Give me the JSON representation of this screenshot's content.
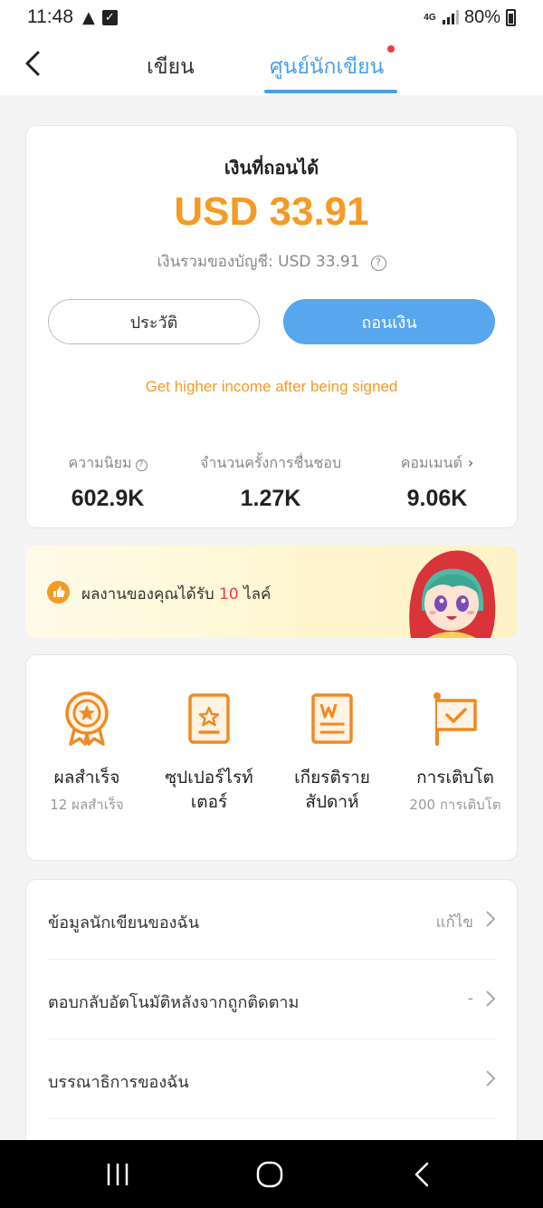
{
  "status_bar": {
    "time": "11:48",
    "network": "4G",
    "battery": "80%"
  },
  "header": {
    "tab_write": "เขียน",
    "tab_writer_center": "ศูนย์นักเขียน"
  },
  "income": {
    "label": "เงินที่ถอนได้",
    "amount": "USD 33.91",
    "total_text": "เงินรวมของบัญชี: USD 33.91",
    "history_button": "ประวัติ",
    "withdraw_button": "ถอนเงิน",
    "signed_promo": "Get higher income after being signed"
  },
  "stats": [
    {
      "label": "ความนิยม",
      "value": "602.9K"
    },
    {
      "label": "จำนวนครั้งการชื่นชอบ",
      "value": "1.27K"
    },
    {
      "label": "คอมเมนต์",
      "value": "9.06K"
    }
  ],
  "banner": {
    "text_before": "ผลงานของคุณได้รับ",
    "count": "10",
    "text_after": "ไลค์"
  },
  "achievements": [
    {
      "title": "ผลสำเร็จ",
      "title2": "",
      "subtitle": "12 ผลสำเร็จ",
      "icon": "medal-icon"
    },
    {
      "title": "ซุปเปอร์ไรท์",
      "title2": "เตอร์",
      "subtitle": "",
      "icon": "star-book-icon"
    },
    {
      "title": "เกียรติราย",
      "title2": "สัปดาห์",
      "subtitle": "",
      "icon": "weekly-honor-icon"
    },
    {
      "title": "การเติบโต",
      "title2": "",
      "subtitle": "200 การเติบโต",
      "icon": "growth-flag-icon"
    }
  ],
  "menu": [
    {
      "label": "ข้อมูลนักเขียนของฉัน",
      "value": "แก้ไข"
    },
    {
      "label": "ตอบกลับอัตโนมัติหลังจากถูกติดตาม",
      "value": "-"
    },
    {
      "label": "บรรณาธิการของฉัน",
      "value": ""
    }
  ],
  "colors": {
    "accent_blue": "#4a9eea",
    "accent_orange": "#f59a23",
    "badge_red": "#f0394b"
  }
}
